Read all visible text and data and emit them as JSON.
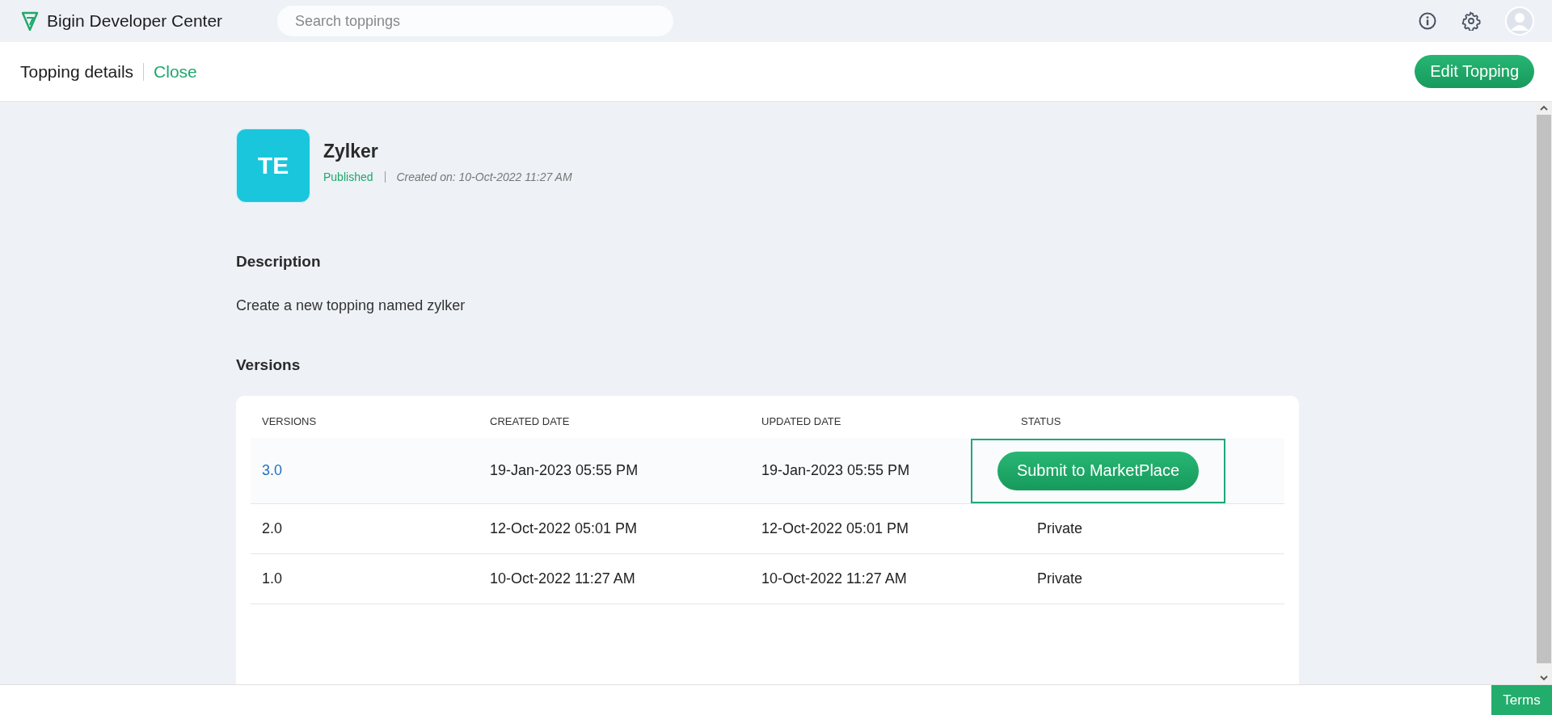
{
  "app": {
    "title": "Bigin Developer Center",
    "search": {
      "placeholder": "Search toppings"
    }
  },
  "subheader": {
    "title": "Topping details",
    "close": "Close",
    "action": "Edit Topping"
  },
  "topping": {
    "initials": "TE",
    "name": "Zylker",
    "status": "Published",
    "created": "Created on: 10-Oct-2022 11:27 AM"
  },
  "description": {
    "heading": "Description",
    "text": "Create a new topping named zylker"
  },
  "versions": {
    "heading": "Versions",
    "columns": [
      "VERSIONS",
      "CREATED DATE",
      "UPDATED DATE",
      "STATUS"
    ],
    "rows": [
      {
        "version": "3.0",
        "version_is_link": true,
        "created": "19-Jan-2023 05:55 PM",
        "updated": "19-Jan-2023 05:55 PM",
        "status": {
          "kind": "button",
          "text": "Submit to MarketPlace"
        },
        "selected": true
      },
      {
        "version": "2.0",
        "version_is_link": false,
        "created": "12-Oct-2022 05:01 PM",
        "updated": "12-Oct-2022 05:01 PM",
        "status": {
          "kind": "text",
          "text": "Private"
        },
        "selected": false
      },
      {
        "version": "1.0",
        "version_is_link": false,
        "created": "10-Oct-2022 11:27 AM",
        "updated": "10-Oct-2022 11:27 AM",
        "status": {
          "kind": "text",
          "text": "Private"
        },
        "selected": false
      }
    ]
  },
  "footer": {
    "terms": "Terms"
  }
}
